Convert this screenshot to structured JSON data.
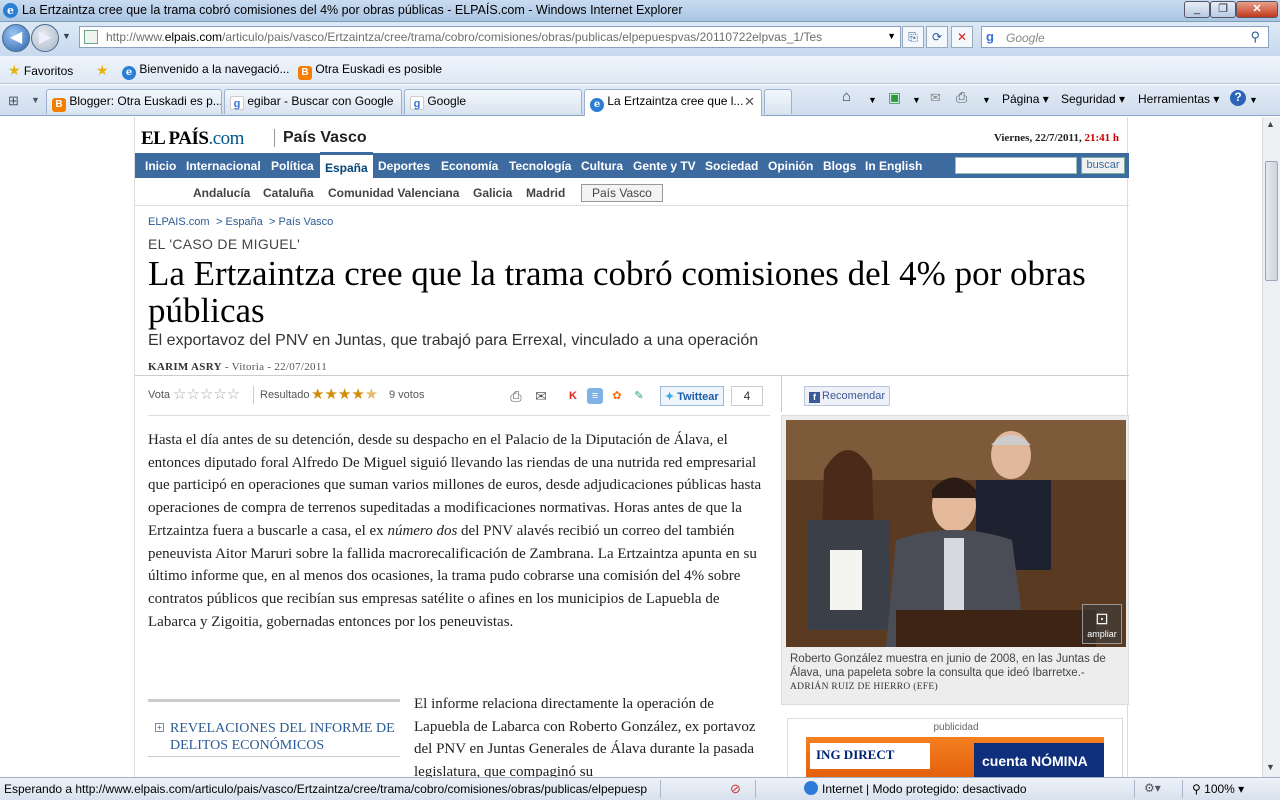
{
  "window": {
    "title": "La Ertzaintza cree que la trama cobró comisiones del 4% por obras públicas - ELPAÍS.com - Windows Internet Explorer"
  },
  "address": {
    "url_prefix": "http://www.",
    "url_domain": "elpais.com",
    "url_rest": "/articulo/pais/vasco/Ertzaintza/cree/trama/cobro/comisiones/obras/publicas/elpepuespvas/20110722elpvas_1/Tes",
    "search_placeholder": "Google"
  },
  "favorites": {
    "label": "Favoritos",
    "items": [
      "Bienvenido a la navegació...",
      "Otra Euskadi es posible"
    ]
  },
  "tabs": [
    {
      "label": "Blogger: Otra Euskadi es p..."
    },
    {
      "label": "egibar - Buscar con Google"
    },
    {
      "label": "Google"
    },
    {
      "label": "La Ertzaintza cree que l..."
    }
  ],
  "commandbar": {
    "page": "Página",
    "security": "Seguridad",
    "tools": "Herramientas"
  },
  "site": {
    "logo_main": "EL PAÍS",
    "logo_suffix": ".com",
    "section": "País Vasco",
    "date": "Viernes, 22/7/2011,",
    "time": "21:41 h"
  },
  "nav": [
    "Inicio",
    "Internacional",
    "Política",
    "España",
    "Deportes",
    "Economía",
    "Tecnología",
    "Cultura",
    "Gente y TV",
    "Sociedad",
    "Opinión",
    "Blogs",
    "In English"
  ],
  "nav_search_button": "buscar",
  "subnav": [
    "Andalucía",
    "Cataluña",
    "Comunidad Valenciana",
    "Galicia",
    "Madrid",
    "País Vasco"
  ],
  "breadcrumb": [
    "ELPAIS.com",
    ">  España",
    ">  País Vasco"
  ],
  "article": {
    "kicker": "EL 'CASO DE MIGUEL'",
    "headline": "La Ertzaintza cree que la trama cobró comisiones del 4% por obras públicas",
    "subhead": "El exportavoz del PNV en Juntas, que trabajó para Errexal, vinculado a una operación",
    "author": "KARIM ASRY",
    "place_date": " - Vitoria - 22/07/2011",
    "body_p1_a": "Hasta el día antes de su detención, desde su despacho en el Palacio de la Diputación de Álava, el entonces diputado foral Alfredo De Miguel siguió llevando las riendas de una nutrida red empresarial que participó en operaciones que suman varios millones de euros, desde adjudicaciones públicas hasta operaciones de compra de terrenos supeditadas a modificaciones normativas. Horas antes de que la Ertzaintza fuera a buscarle a casa, el ex ",
    "body_p1_em": "número dos",
    "body_p1_b": " del PNV alavés recibió un correo del también peneuvista Aitor Maruri sobre la fallida macrorecalificación de Zambrana. La Ertzaintza apunta en su último informe que, en al menos dos ocasiones, la trama pudo cobrarse una comisión del 4% sobre contratos públicos que recibían sus empresas satélite o afines en los municipios de Lapuebla de Labarca y Zigoitia, gobernadas entonces por los peneuvistas.",
    "body_p2": "El informe relaciona directamente la operación de Lapuebla de Labarca con Roberto González, ex portavoz del PNV en Juntas Generales de Álava durante la pasada legislatura, que compaginó su"
  },
  "tools": {
    "vote_label": "Vota",
    "result_label": "Resultado",
    "votes": "9 votos",
    "rating": 4.5,
    "twitter": "Twittear",
    "twitter_count": "4",
    "facebook": "Recomendar"
  },
  "related": {
    "title": "REVELACIONES DEL INFORME DE DELITOS ECONÓMICOS"
  },
  "photo": {
    "enlarge": "ampliar",
    "caption": "Roberto González muestra en junio de 2008, en las Juntas de Álava, una papeleta sobre la consulta que ideó Ibarretxe.-",
    "credit": "ADRIÁN RUIZ DE HIERRO (EFE)"
  },
  "ad": {
    "label": "publicidad",
    "brand": "ING DIRECT",
    "product": "cuenta NÓMINA"
  },
  "status": {
    "text": "Esperando a http://www.elpais.com/articulo/pais/vasco/Ertzaintza/cree/trama/cobro/comisiones/obras/publicas/elpepuesp",
    "zone": "Internet | Modo protegido: desactivado",
    "zoom": "100%"
  }
}
